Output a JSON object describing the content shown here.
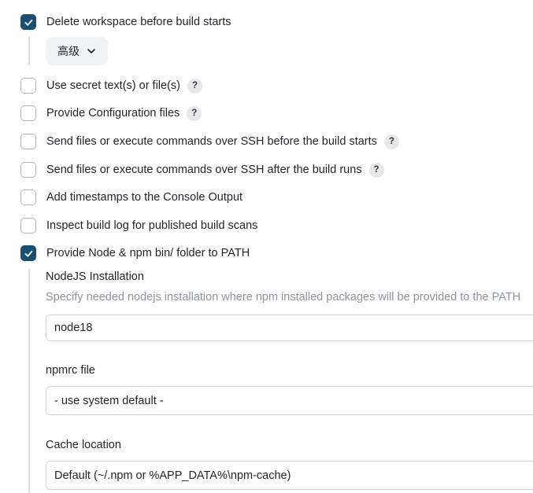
{
  "options": [
    {
      "label": "Delete workspace before build starts",
      "checked": true,
      "help": false
    },
    {
      "label": "Use secret text(s) or file(s)",
      "checked": false,
      "help": true
    },
    {
      "label": "Provide Configuration files",
      "checked": false,
      "help": true
    },
    {
      "label": "Send files or execute commands over SSH before the build starts",
      "checked": false,
      "help": true
    },
    {
      "label": "Send files or execute commands over SSH after the build runs",
      "checked": false,
      "help": true
    },
    {
      "label": "Add timestamps to the Console Output",
      "checked": false,
      "help": false
    },
    {
      "label": "Inspect build log for published build scans",
      "checked": false,
      "help": false
    },
    {
      "label": "Provide Node & npm bin/ folder to PATH",
      "checked": true,
      "help": false
    }
  ],
  "help_glyph": "?",
  "advanced_button": {
    "label": "高级",
    "icon": "chevron-down-icon"
  },
  "nodejs": {
    "installation_label": "NodeJS Installation",
    "installation_description": "Specify needed nodejs installation where npm installed packages will be provided to the PATH",
    "installation_value": "node18",
    "npmrc_label": "npmrc file",
    "npmrc_value": "- use system default -",
    "cache_label": "Cache location",
    "cache_value": "Default (~/.npm or %APP_DATA%\\npm-cache)"
  },
  "colors": {
    "checked": "#1b4f6f",
    "help_bg": "#e7e8ea",
    "muted_text": "#8c939c"
  }
}
